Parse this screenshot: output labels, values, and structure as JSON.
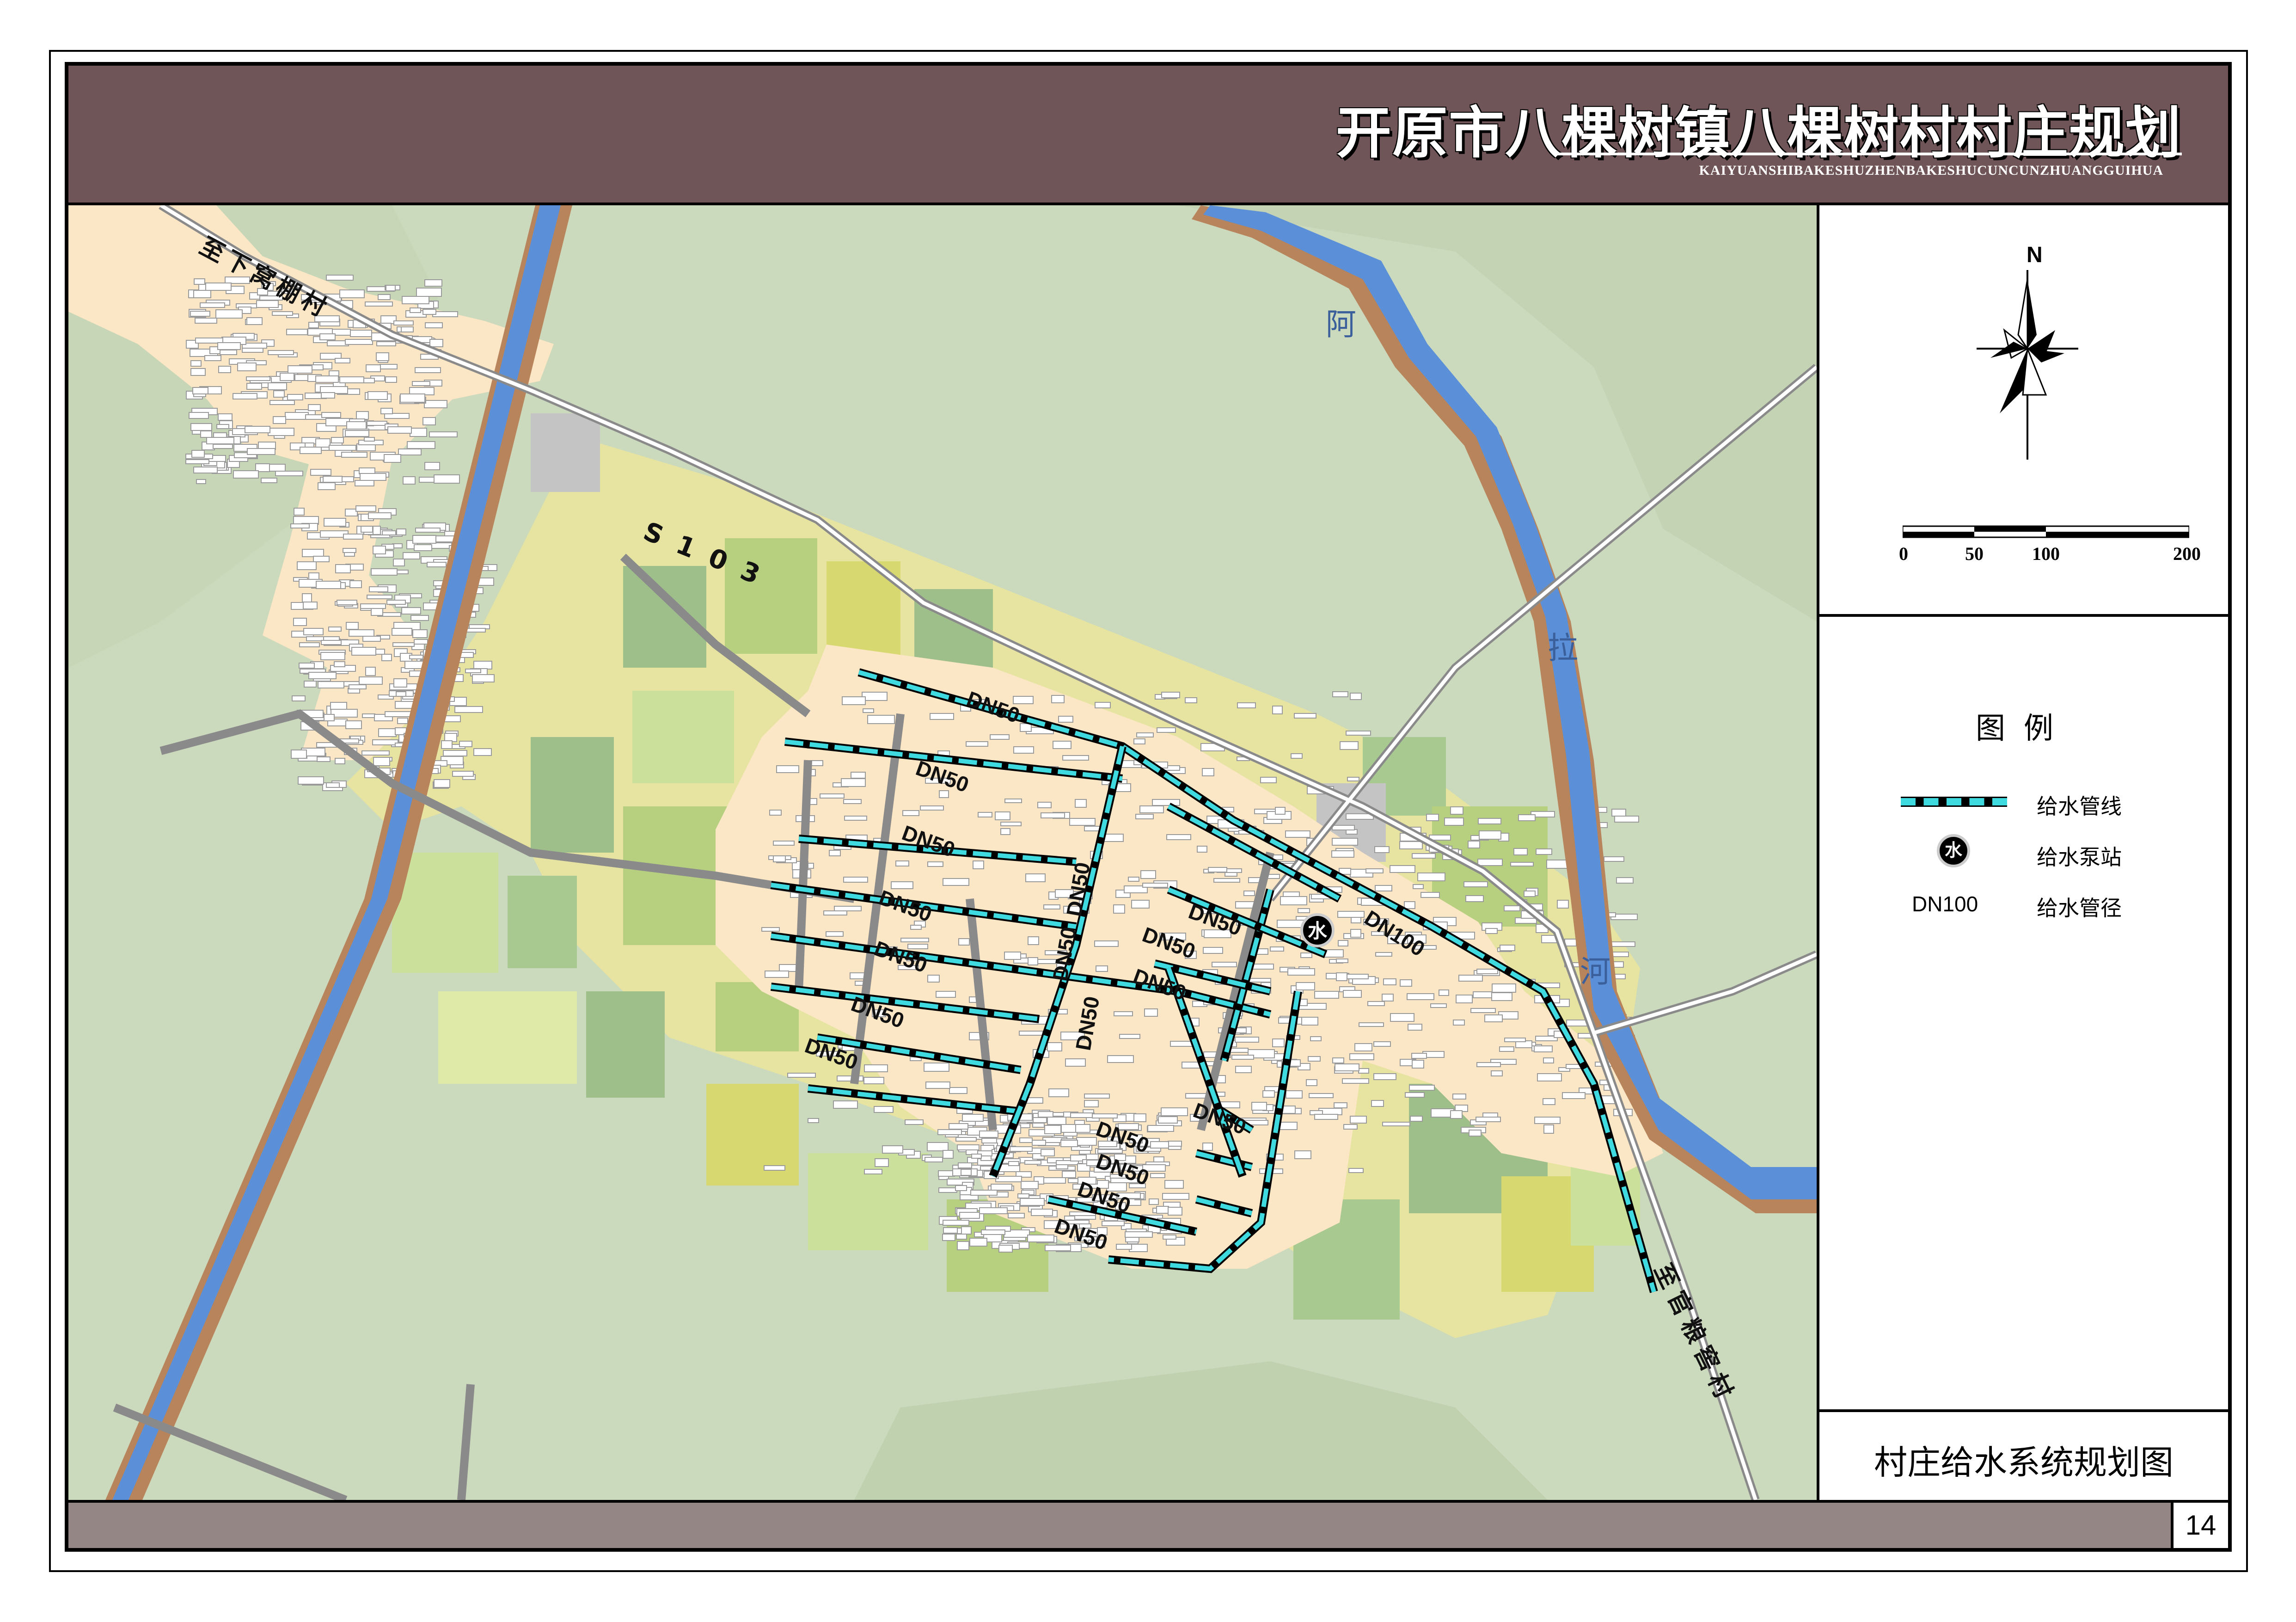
{
  "title": {
    "main": "开原市八棵树镇八棵树村村庄规划",
    "pinyin": "KAIYUANSHIBAKESHUZHENBAKESHUCUNCUNZHUANGGUIHUA"
  },
  "map": {
    "road_labels": {
      "north_west": "至下窝棚村",
      "highway": "S103",
      "south_east": "至官粮窖村"
    },
    "river_name": "阿拉河",
    "pipe_labels": [
      "DN50",
      "DN50",
      "DN50",
      "DN50",
      "DN50",
      "DN50",
      "DN50",
      "DN50",
      "DN50",
      "DN50",
      "DN50",
      "DN50",
      "DN50",
      "DN50",
      "DN50",
      "DN50",
      "DN50",
      "DN50",
      "DN100"
    ],
    "pump_station_char": "水",
    "colors": {
      "pipe": "#3fd9e0",
      "background": "#cbd9bd",
      "village": "#fbe6c5",
      "farmland_yellow": "#e6e4a0",
      "farmland_green": "#a8c98f",
      "river": "#5b8fd8",
      "river_bank": "#b8845c"
    }
  },
  "compass": {
    "north": "N"
  },
  "scale_bar": {
    "ticks": [
      "0",
      "50",
      "100",
      "200"
    ]
  },
  "legend": {
    "title": "图例",
    "items": [
      {
        "symbol": "pipe-line",
        "label": "给水管线"
      },
      {
        "symbol": "pump-station",
        "label": "给水泵站",
        "symbol_text": "水"
      },
      {
        "symbol": "pipe-diameter",
        "label": "给水管径",
        "symbol_text": "DN100"
      }
    ]
  },
  "drawing_name": "村庄给水系统规划图",
  "page_number": "14"
}
